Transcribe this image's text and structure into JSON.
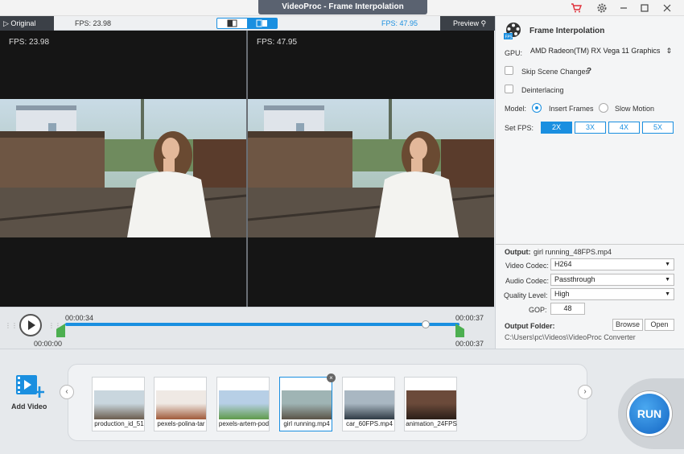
{
  "window": {
    "title": "VideoProc - Frame Interpolation"
  },
  "preview": {
    "original_tab": "Original",
    "preview_tab": "Preview",
    "fps_left_header": "FPS: 23.98",
    "fps_right_header": "FPS: 47.95",
    "fps_left_overlay": "FPS: 23.98",
    "fps_right_overlay": "FPS: 47.95"
  },
  "timeline": {
    "start_marker": "00:00:34",
    "end_marker": "00:00:37",
    "start_time": "00:00:00",
    "end_time": "00:00:37",
    "playhead_fraction": 0.915
  },
  "settings": {
    "title": "Frame Interpolation",
    "gpu_label": "GPU:",
    "gpu_value": "AMD Radeon(TM) RX Vega 11 Graphics",
    "skip_scene_label": "Skip Scene Changes",
    "help_mark": "?",
    "deinterlacing_label": "Deinterlacing",
    "model_label": "Model:",
    "model_options": [
      "Insert Frames",
      "Slow Motion"
    ],
    "model_selected": "Insert Frames",
    "setfps_label": "Set FPS:",
    "fps_options": [
      "2X",
      "3X",
      "4X",
      "5X"
    ],
    "fps_selected": "2X"
  },
  "output": {
    "output_label": "Output:",
    "output_file": "girl running_48FPS.mp4",
    "video_codec_label": "Video Codec:",
    "video_codec": "H264",
    "audio_codec_label": "Audio Codec:",
    "audio_codec": "Passthrough",
    "quality_label": "Quality Level:",
    "quality": "High",
    "gop_label": "GOP:",
    "gop": "48",
    "folder_label": "Output Folder:",
    "browse": "Browse",
    "open": "Open",
    "folder_path": "C:\\Users\\pc\\Videos\\VideoProc Converter"
  },
  "library": {
    "add_video": "Add Video",
    "run": "RUN",
    "files": [
      {
        "name": "production_id_51",
        "colors": [
          "#c9d6de",
          "#6b5d4e"
        ]
      },
      {
        "name": "pexels-polina-tar",
        "colors": [
          "#efe9e4",
          "#a05a3a"
        ]
      },
      {
        "name": "pexels-artem-pod",
        "colors": [
          "#b7cfe6",
          "#5f9a4a"
        ]
      },
      {
        "name": "girl running.mp4",
        "colors": [
          "#9fb4b4",
          "#5a5347"
        ]
      },
      {
        "name": "car_60FPS.mp4",
        "colors": [
          "#a9b7c2",
          "#2f3a44"
        ]
      },
      {
        "name": "animation_24FPS",
        "colors": [
          "#6b4a3a",
          "#2a1e18"
        ]
      }
    ],
    "selected_index": 3
  }
}
